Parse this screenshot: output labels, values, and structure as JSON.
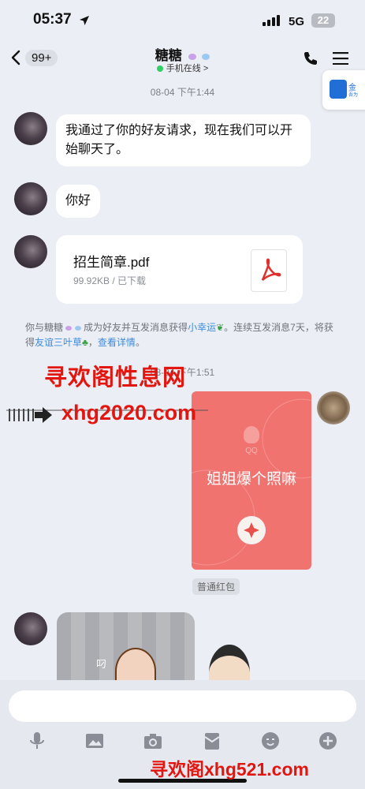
{
  "status_bar": {
    "time": "05:37",
    "network": "5G",
    "battery": "22"
  },
  "header": {
    "unread_count": "99+",
    "contact_name": "糖糖",
    "status": "手机在线",
    "status_chevron": ">"
  },
  "ad_banner": {
    "text1": "金",
    "text2": "吾为"
  },
  "messages": [
    {
      "timestamp": "08-04 下午1:44"
    },
    {
      "text": "我通过了你的好友请求，现在我们可以开始聊天了。"
    },
    {
      "text": "你好"
    },
    {
      "file_name": "招生简章.pdf",
      "file_meta": "99.92KB / 已下载"
    }
  ],
  "system_notice": {
    "part1": "你与糖糖",
    "part2": "成为好友并互发消息获得",
    "link1": "小幸运",
    "part3": "。连续互发消息7天，将获得",
    "link2": "友谊三叶草",
    "link3": "查看详情",
    "end": "。"
  },
  "timestamp2": "08-04 下午1:51",
  "red_packet": {
    "brand": "QQ",
    "message": "姐姐爆个照嘛",
    "label": "普通红包"
  },
  "sticker": {
    "caption": "叼"
  },
  "input": {
    "placeholder": ""
  },
  "watermarks": {
    "line1": "寻欢阁性息网",
    "line2": "xhg2020.com",
    "line3": "寻欢阁xhg521.com"
  },
  "colors": {
    "accent": "#3d8bdc",
    "red_packet": "#f07370",
    "online": "#2fd163",
    "watermark": "#e3160f"
  },
  "icons": [
    "location-arrow-icon",
    "signal-icon",
    "back-chevron-icon",
    "phone-icon",
    "menu-icon",
    "pdf-icon",
    "mic-icon",
    "image-icon",
    "camera-icon",
    "red-packet-icon",
    "emoji-icon",
    "plus-icon"
  ]
}
